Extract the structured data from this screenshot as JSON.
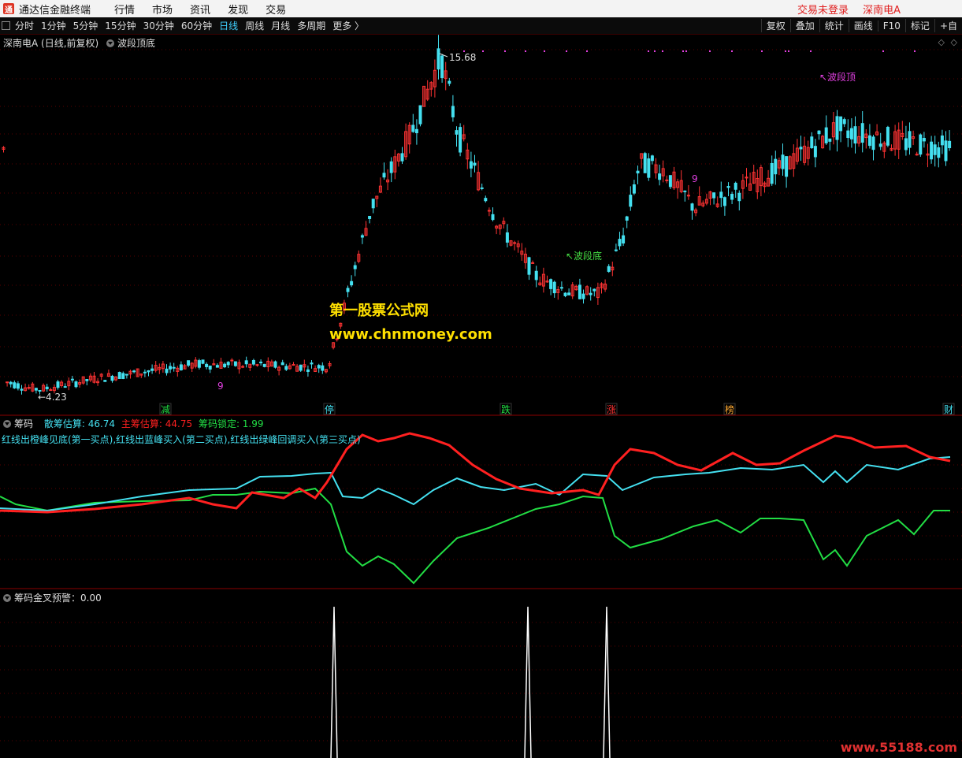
{
  "app": {
    "title": "通达信金融终端",
    "menus": [
      "行情",
      "市场",
      "资讯",
      "发现",
      "交易"
    ],
    "status": "交易未登录",
    "stock": "深南电A"
  },
  "toolbar": {
    "periods": [
      "分时",
      "1分钟",
      "5分钟",
      "15分钟",
      "30分钟",
      "60分钟",
      "日线",
      "周线",
      "月线",
      "多周期",
      "更多 〉"
    ],
    "active": "日线",
    "right_buttons": [
      "复权",
      "叠加",
      "统计",
      "画线",
      "F10",
      "标记",
      "+自"
    ]
  },
  "main_panel": {
    "title": "深南电A (日线,前复权)",
    "indicator": "波段顶底",
    "high_label": "15.68",
    "low_label": "4.23",
    "bottom_label": "波段底",
    "top_label": "波段顶",
    "nine_label": "9",
    "event_markers": [
      "减",
      "停",
      "跌",
      "涨",
      "榜",
      "财"
    ]
  },
  "chip_panel": {
    "name": "筹码",
    "san": "散筹估算: 46.74",
    "zhu": "主筹估算: 44.75",
    "lock": "筹码锁定: 1.99",
    "desc": "红线出橙峰见底(第一买点),红线出蓝峰买入(第二买点),红线出绿峰回调买入(第三买点)"
  },
  "golden_panel": {
    "label": "筹码金叉预警：0.00"
  },
  "watermark": {
    "line1": "第一股票公式网",
    "line2": "www.chnmoney.com",
    "corner": "www.55188.com"
  },
  "colors": {
    "up": "#ff3333",
    "down": "#44e0f0",
    "red_line": "#ff2020",
    "cyan_line": "#44e0f0",
    "green_line": "#22dd44",
    "magenta": "#e040e0"
  },
  "chart_data": {
    "type": "candlestick",
    "symbol": "深南电A",
    "price_points": [
      4.5,
      4.3,
      4.23,
      4.6,
      5.1,
      5.0,
      7.5,
      10.5,
      13.0,
      15.68,
      13.0,
      10.0,
      8.1,
      7.6,
      7.5,
      9.5,
      12.0,
      11.8,
      10.5,
      11.0,
      12.0,
      13.2,
      12.8,
      12.5
    ],
    "chip_series": [
      {
        "name": "散筹估算",
        "color": "cyan",
        "last": 46.74
      },
      {
        "name": "主筹估算",
        "color": "red",
        "last": 44.75
      },
      {
        "name": "筹码锁定",
        "color": "green",
        "last": 1.99
      }
    ],
    "golden_cross_peaks": 3,
    "golden_cross_value": 0.0
  }
}
